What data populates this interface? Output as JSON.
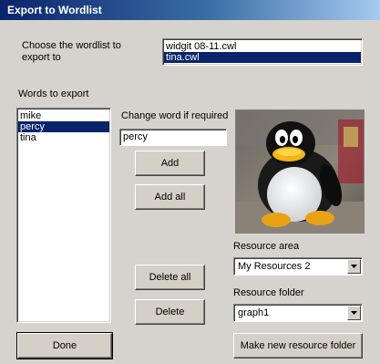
{
  "window": {
    "title": "Export to Wordlist"
  },
  "choose": {
    "label": "Choose the wordlist to\nexport to",
    "items": [
      "widgit 08-11.cwl",
      "tina.cwl"
    ],
    "selected_index": 1
  },
  "words": {
    "label": "Words to export",
    "items": [
      "mike",
      "percy",
      "tina"
    ],
    "selected_index": 1
  },
  "change": {
    "label": "Change word if required",
    "value": "percy"
  },
  "buttons": {
    "add": "Add",
    "add_all": "Add all",
    "delete_all": "Delete all",
    "delete": "Delete",
    "done": "Done",
    "make_folder": "Make new resource folder"
  },
  "resource_area": {
    "label": "Resource area",
    "value": "My Resources 2"
  },
  "resource_folder": {
    "label": "Resource folder",
    "value": "graph1"
  },
  "colors": {
    "selection": "#0a246a",
    "dialog_bg": "#d6d3ce"
  },
  "icons": {
    "dropdown": "chevron-down-icon",
    "picture": "penguin-toy-photo"
  }
}
